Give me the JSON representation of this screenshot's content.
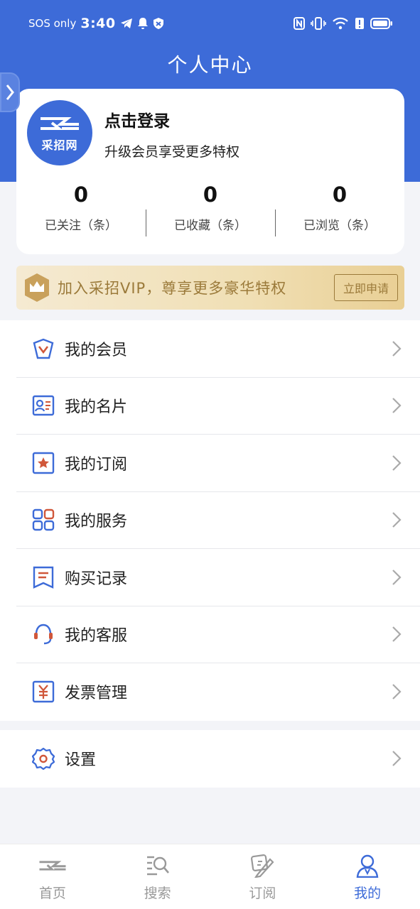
{
  "status_bar": {
    "carrier": "SOS only",
    "time": "3:40"
  },
  "header": {
    "title": "个人中心"
  },
  "profile": {
    "avatar_text": "采招网",
    "login_title": "点击登录",
    "login_subtitle": "升级会员享受更多特权",
    "stats": [
      {
        "value": "0",
        "label": "已关注（条）"
      },
      {
        "value": "0",
        "label": "已收藏（条）"
      },
      {
        "value": "0",
        "label": "已浏览（条）"
      }
    ]
  },
  "vip_banner": {
    "text": "加入采招VIP，尊享更多豪华特权",
    "button_label": "立即申请"
  },
  "menu": {
    "items": [
      {
        "label": "我的会员",
        "icon": "member-icon"
      },
      {
        "label": "我的名片",
        "icon": "card-icon"
      },
      {
        "label": "我的订阅",
        "icon": "subscribe-icon"
      },
      {
        "label": "我的服务",
        "icon": "service-icon"
      },
      {
        "label": "购买记录",
        "icon": "purchase-record-icon"
      },
      {
        "label": "我的客服",
        "icon": "customer-service-icon"
      },
      {
        "label": "发票管理",
        "icon": "invoice-icon"
      }
    ],
    "settings": {
      "label": "设置",
      "icon": "gear-icon"
    }
  },
  "tabbar": {
    "items": [
      {
        "label": "首页",
        "icon": "home-icon"
      },
      {
        "label": "搜索",
        "icon": "search-icon"
      },
      {
        "label": "订阅",
        "icon": "subscribe-tab-icon"
      },
      {
        "label": "我的",
        "icon": "profile-icon"
      }
    ],
    "active_index": 3
  },
  "colors": {
    "primary": "#3d6bd8",
    "accent_orange": "#d0573a",
    "vip_gold": "#9b7a3a"
  }
}
